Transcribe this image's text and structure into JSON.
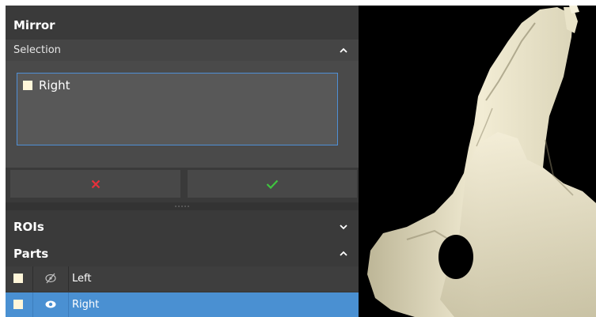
{
  "mirror_panel": {
    "title": "Mirror",
    "selection": {
      "header": "Selection",
      "items": [
        {
          "label": "Right",
          "checked": false
        }
      ]
    },
    "cancel_icon": "x-icon",
    "confirm_icon": "check-icon",
    "cancel_color": "#e8303a",
    "confirm_color": "#3fc43f"
  },
  "rois": {
    "header": "ROIs"
  },
  "parts": {
    "header": "Parts",
    "rows": [
      {
        "visibility_icon": "eye-off-icon",
        "name": "Left",
        "selected": false
      },
      {
        "visibility_icon": "eye-icon",
        "name": "Right",
        "selected": true
      }
    ]
  },
  "colors": {
    "selection_highlight": "#4a90d2",
    "listbox_border": "#4f8fd6",
    "bone": "#ece6cd"
  }
}
